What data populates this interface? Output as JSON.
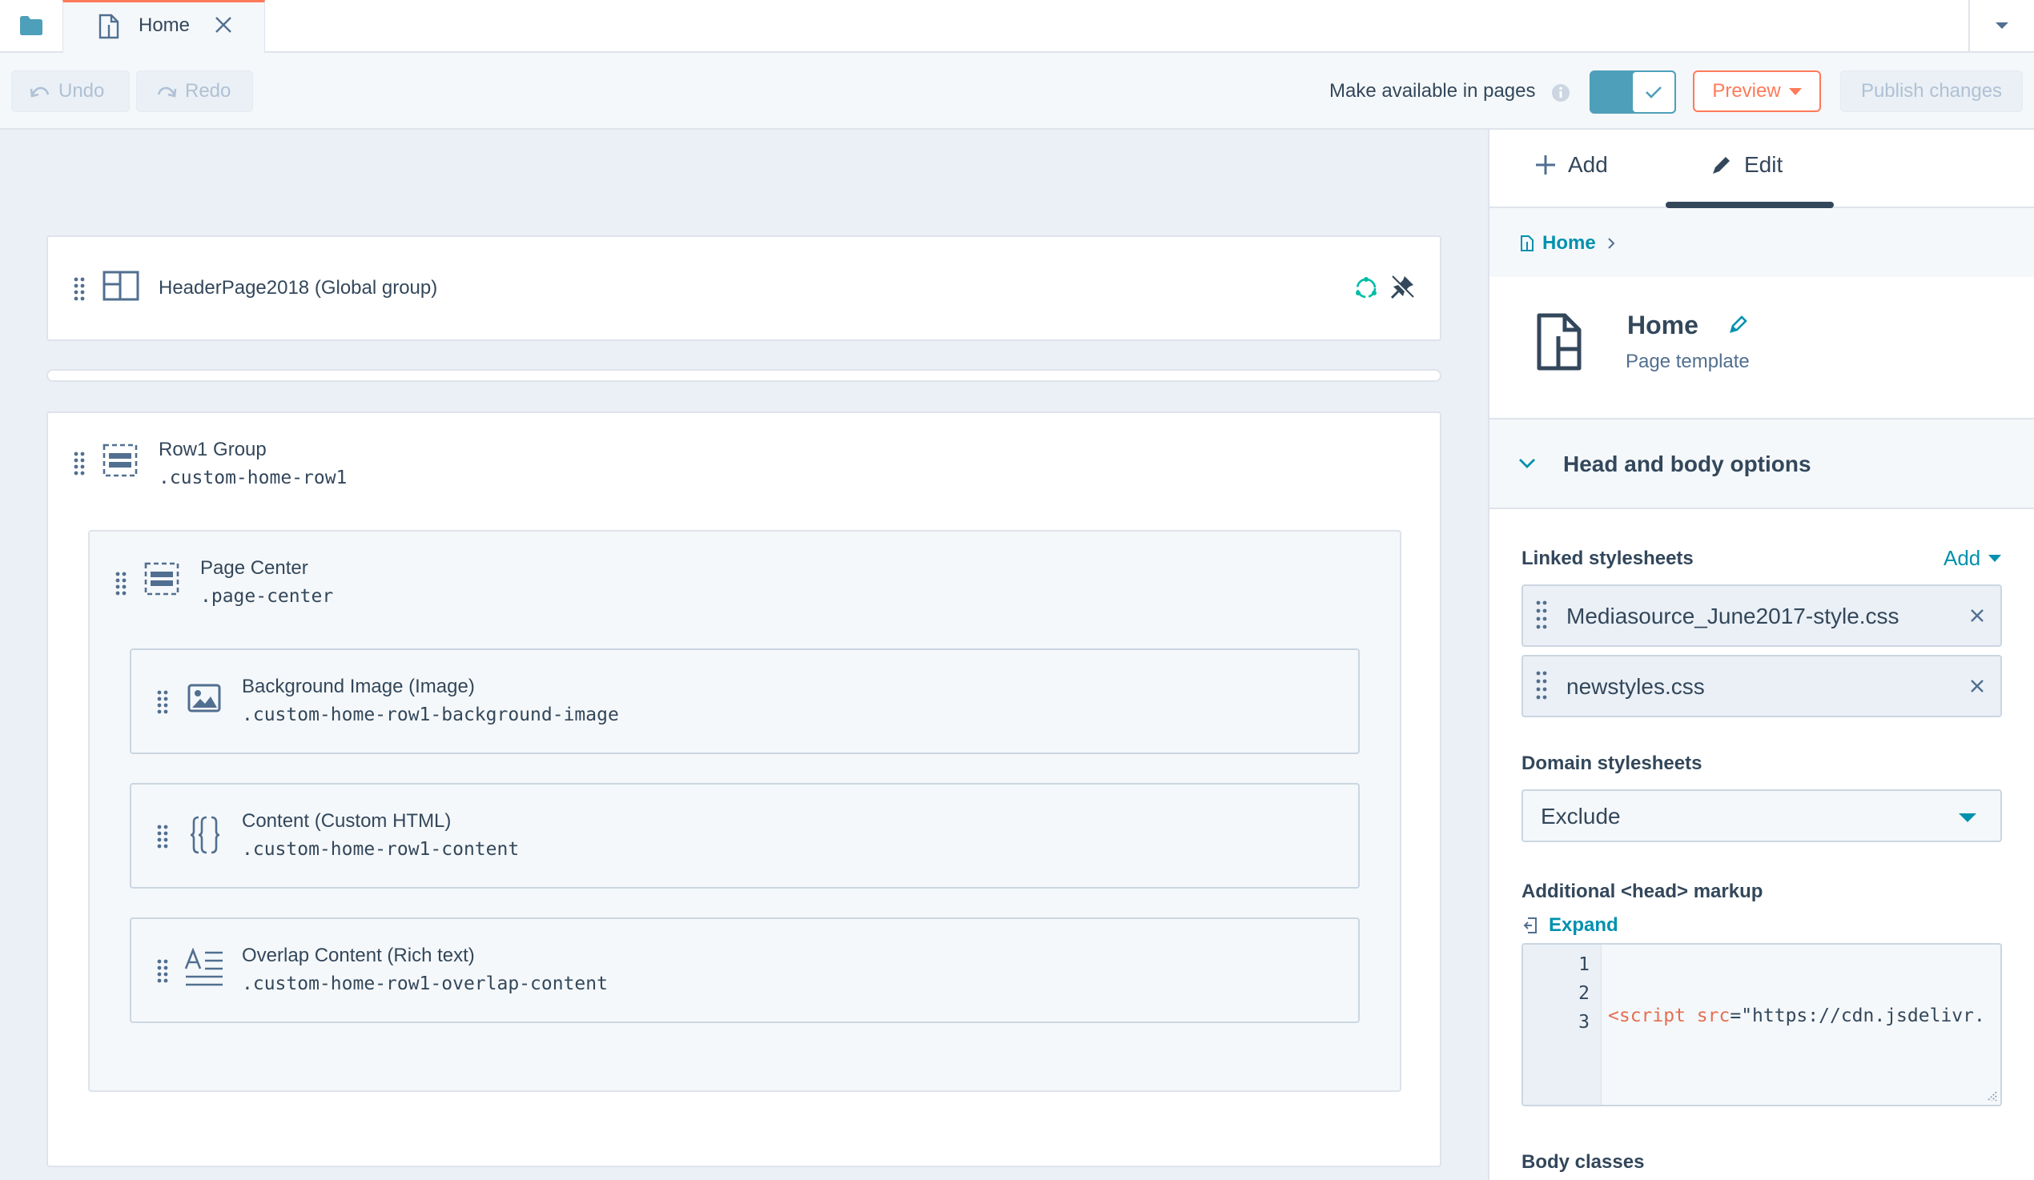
{
  "tabs": {
    "active_label": "Home"
  },
  "toolbar": {
    "undo_label": "Undo",
    "redo_label": "Redo",
    "availability_label": "Make available in pages",
    "availability_enabled": true,
    "preview_label": "Preview",
    "publish_label": "Publish changes"
  },
  "canvas": {
    "header_module": {
      "title": "HeaderPage2018 (Global group)"
    },
    "row_group": {
      "title": "Row1 Group",
      "class_name": ".custom-home-row1"
    },
    "page_center": {
      "title": "Page Center",
      "class_name": ".page-center"
    },
    "modules": [
      {
        "title": "Background Image (Image)",
        "class_name": ".custom-home-row1-background-image",
        "icon": "image-icon"
      },
      {
        "title": "Content (Custom HTML)",
        "class_name": ".custom-home-row1-content",
        "icon": "curly-braces-icon"
      },
      {
        "title": "Overlap Content (Rich text)",
        "class_name": ".custom-home-row1-overlap-content",
        "icon": "rich-text-icon"
      }
    ]
  },
  "panel": {
    "tab_add": "Add",
    "tab_edit": "Edit",
    "active_tab": "Edit",
    "breadcrumb": "Home",
    "template_name": "Home",
    "template_type": "Page template",
    "section_title": "Head and body options",
    "linked_stylesheets_label": "Linked stylesheets",
    "add_label": "Add",
    "stylesheets": [
      "Mediasource_June2017-style.css",
      "newstyles.css"
    ],
    "domain_stylesheets_label": "Domain stylesheets",
    "domain_stylesheets_value": "Exclude",
    "head_markup_label": "Additional <head> markup",
    "expand_label": "Expand",
    "code": {
      "line_numbers": [
        "1",
        "2",
        "3"
      ],
      "line3_tag": "<script",
      "line3_attr": "src",
      "line3_rest": "=\"https://cdn.jsdelivr."
    },
    "body_classes_label": "Body classes"
  },
  "colors": {
    "accent_orange": "#ff7a59",
    "link_teal": "#0091ae",
    "toggle_on": "#4e9fb9",
    "text_dark": "#33475b",
    "canvas_bg": "#eaf0f6"
  }
}
